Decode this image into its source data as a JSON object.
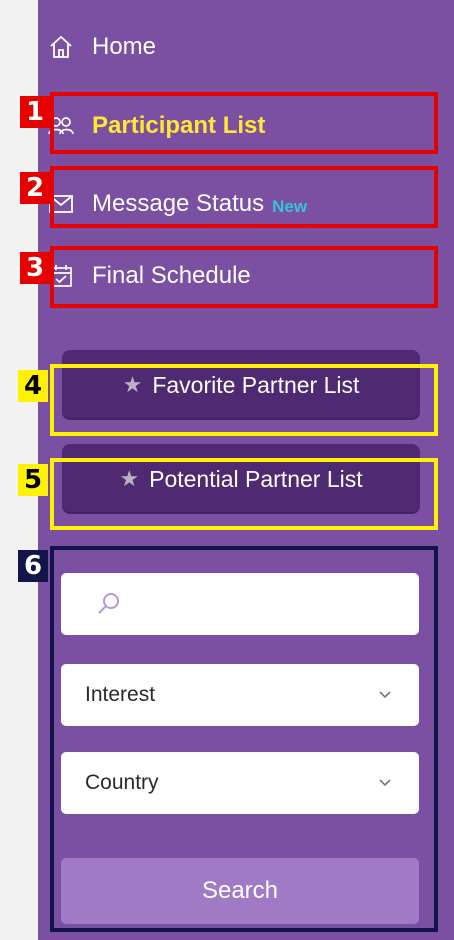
{
  "nav": {
    "home": "Home",
    "participant_list": "Participant List",
    "message_status": "Message Status",
    "message_status_badge": "New",
    "final_schedule": "Final Schedule"
  },
  "partners": {
    "favorite": "Favorite Partner List",
    "potential": "Potential Partner List"
  },
  "search": {
    "placeholder": "",
    "interest_selected": "Interest",
    "country_selected": "Country",
    "button_label": "Search"
  },
  "markers": [
    "1",
    "2",
    "3",
    "4",
    "5",
    "6"
  ],
  "colors": {
    "sidebar": "#7b4fa2",
    "active_text": "#ffe733",
    "new_badge": "#35c6d6",
    "partner_button": "#4f2a73",
    "search_button": "#a17ac6",
    "marker_red": "#e60000",
    "marker_yellow": "#fff200",
    "marker_navy": "#13144a"
  }
}
